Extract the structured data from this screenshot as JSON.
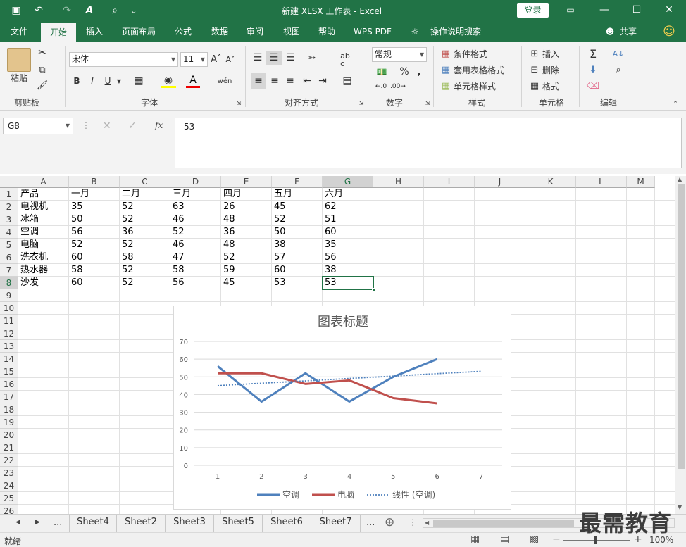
{
  "titlebar": {
    "title": "新建 XLSX 工作表 - Excel",
    "login": "登录",
    "qa_save": "▣",
    "qa_undo": "↶",
    "qa_redo": "↷",
    "qa_format": "A",
    "qa_preview": "⌕",
    "qa_more": "⌄",
    "min": "—",
    "restore": "▭",
    "max": "☐",
    "close": "✕"
  },
  "tabs": [
    "文件",
    "开始",
    "插入",
    "页面布局",
    "公式",
    "数据",
    "审阅",
    "视图",
    "帮助",
    "WPS PDF",
    "操作说明搜索"
  ],
  "share": "共享",
  "ribbon": {
    "paste": "粘贴",
    "clipboard": "剪贴板",
    "font_name": "宋体",
    "font_size": "11",
    "font_group": "字体",
    "bold": "B",
    "italic": "I",
    "underline": "U",
    "align_group": "对齐方式",
    "number_format": "常规",
    "number_group": "数字",
    "percent": "%",
    "comma": ",",
    "cond_format": "条件格式",
    "table_format": "套用表格格式",
    "cell_style": "单元格样式",
    "style_group": "样式",
    "insert": "插入",
    "delete": "删除",
    "format": "格式",
    "cells_group": "单元格",
    "sum": "Σ",
    "sort": "A↓",
    "find": "⌕",
    "edit_group": "编辑"
  },
  "formula_bar": {
    "name_box": "G8",
    "cancel": "✕",
    "confirm": "✓",
    "fx": "fx",
    "value": "53"
  },
  "columns": [
    "A",
    "B",
    "C",
    "D",
    "E",
    "F",
    "G",
    "H",
    "I",
    "J",
    "K",
    "L",
    "M"
  ],
  "rows": [
    "1",
    "2",
    "3",
    "4",
    "5",
    "6",
    "7",
    "8",
    "9",
    "10",
    "11",
    "12",
    "13",
    "14",
    "15",
    "16",
    "17",
    "18",
    "19",
    "20",
    "21",
    "22",
    "23",
    "24",
    "25",
    "26"
  ],
  "table": [
    [
      "产品",
      "一月",
      "二月",
      "三月",
      "四月",
      "五月",
      "六月"
    ],
    [
      "电视机",
      "35",
      "52",
      "63",
      "26",
      "45",
      "62"
    ],
    [
      "冰箱",
      "50",
      "52",
      "46",
      "48",
      "52",
      "51"
    ],
    [
      "空调",
      "56",
      "36",
      "52",
      "36",
      "50",
      "60"
    ],
    [
      "电脑",
      "52",
      "52",
      "46",
      "48",
      "38",
      "35"
    ],
    [
      "洗衣机",
      "60",
      "58",
      "47",
      "52",
      "57",
      "56"
    ],
    [
      "热水器",
      "58",
      "52",
      "58",
      "59",
      "60",
      "38"
    ],
    [
      "沙发",
      "60",
      "52",
      "56",
      "45",
      "53",
      "53"
    ]
  ],
  "chart_data": {
    "type": "line",
    "title": "图表标题",
    "x": [
      1,
      2,
      3,
      4,
      5,
      6,
      7
    ],
    "ylim": [
      0,
      70
    ],
    "yticks": [
      0,
      10,
      20,
      30,
      40,
      50,
      60,
      70
    ],
    "grid": true,
    "legend": "bottom",
    "series": [
      {
        "name": "空调",
        "values": [
          56,
          36,
          52,
          36,
          50,
          60
        ],
        "color": "#4f81bd",
        "style": "solid"
      },
      {
        "name": "电脑",
        "values": [
          52,
          52,
          46,
          48,
          38,
          35
        ],
        "color": "#c0504d",
        "style": "solid"
      },
      {
        "name": "线性 (空调)",
        "values": [
          45,
          46.4,
          47.7,
          49.1,
          50.4,
          51.8,
          53.1
        ],
        "color": "#4f81bd",
        "style": "dotted"
      }
    ]
  },
  "sheets": [
    "Sheet4",
    "Sheet2",
    "Sheet3",
    "Sheet5",
    "Sheet6",
    "Sheet7"
  ],
  "sheet_nav": {
    "prev": "◀",
    "next": "▶",
    "more": "...",
    "more_right": "...",
    "add": "⊕"
  },
  "status": {
    "ready": "就绪",
    "zoom": "100%",
    "minus": "−",
    "plus": "+"
  },
  "watermark": "最需教育",
  "colors": {
    "accent": "#217346",
    "ribbon_bg": "#f3f3f3"
  }
}
